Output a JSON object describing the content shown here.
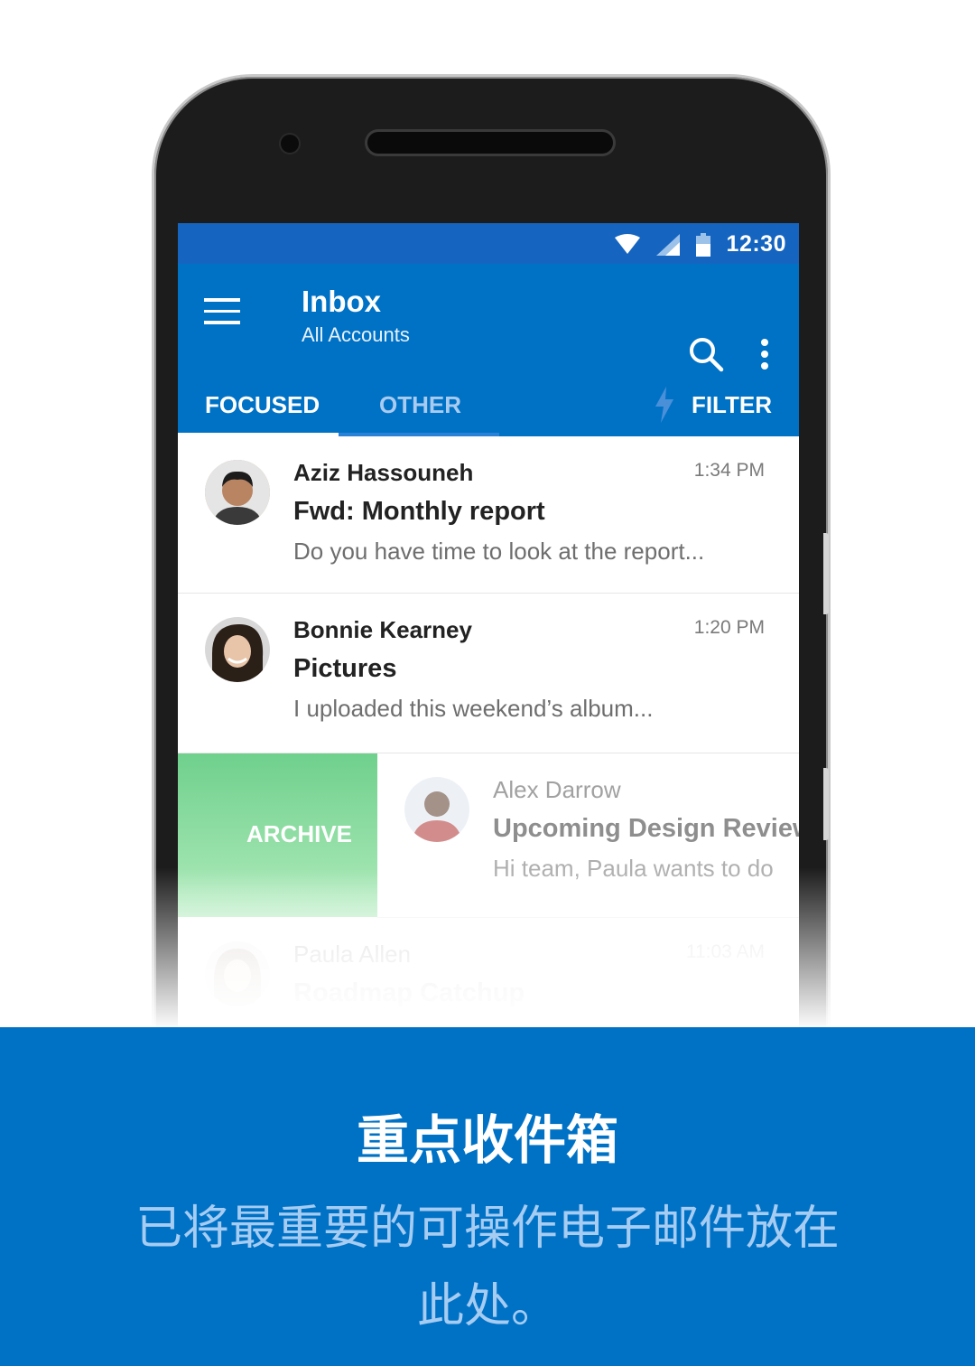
{
  "status_bar": {
    "time": "12:30"
  },
  "app_bar": {
    "title": "Inbox",
    "subtitle": "All Accounts",
    "icons": [
      "menu-icon",
      "search-icon",
      "more-vert-icon"
    ]
  },
  "tabs": {
    "focused": "FOCUSED",
    "other": "OTHER",
    "filter": "FILTER"
  },
  "messages": [
    {
      "sender": "Aziz Hassouneh",
      "subject": "Fwd: Monthly report",
      "preview": "Do you have time to look at the report...",
      "time": "1:34 PM"
    },
    {
      "sender": "Bonnie Kearney",
      "subject": "Pictures",
      "preview": "I uploaded this weekend’s album...",
      "time": "1:20 PM"
    },
    {
      "sender": "Alex Darrow",
      "subject": "Upcoming Design Review",
      "preview": "Hi team, Paula wants to do",
      "time": ""
    },
    {
      "sender": "Paula Allen",
      "subject": "Roadmap Catchup",
      "preview": "",
      "time": "11:03 AM"
    }
  ],
  "swipe_action": {
    "label": "ARCHIVE"
  },
  "caption": {
    "title": "重点收件箱",
    "subtitle": "已将最重要的可操作电子邮件放在此处。"
  },
  "colors": {
    "brand_blue": "#0072c6",
    "status_blue": "#1565c0",
    "archive_green": "#6fd08c"
  }
}
